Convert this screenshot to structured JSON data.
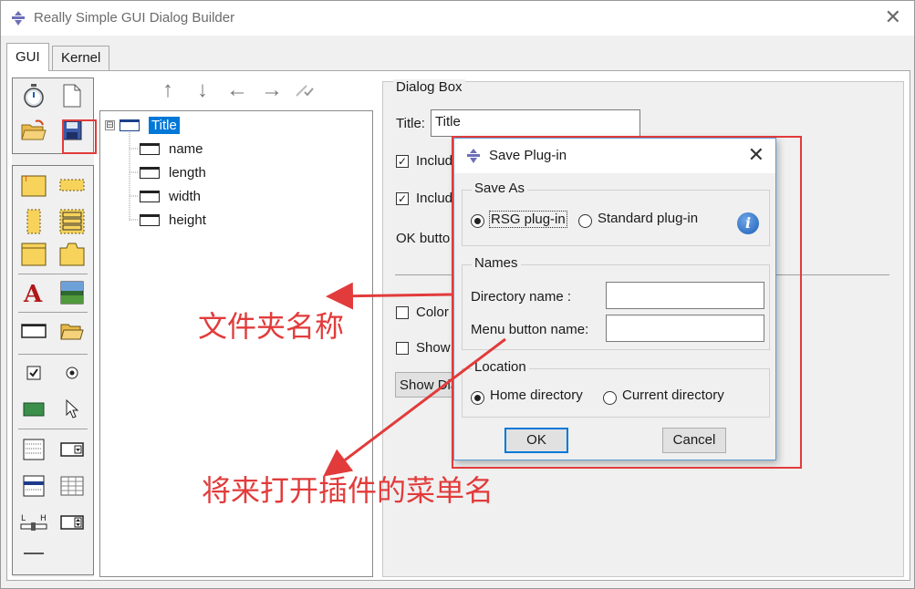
{
  "window": {
    "title": "Really Simple GUI Dialog Builder",
    "close_glyph": "✕"
  },
  "tabs": [
    {
      "label": "GUI",
      "active": true
    },
    {
      "label": "Kernel",
      "active": false
    }
  ],
  "toolbox": {
    "top_icons": [
      "stopwatch-icon",
      "new-document-icon",
      "open-folder-icon",
      "save-floppy-icon"
    ],
    "widget_icons": [
      "dialog-frame-icon",
      "horizontal-frame-icon",
      "vertical-frame-icon",
      "vertical-aligned-icon",
      "tab-book-icon",
      "tab-item-icon",
      "label-text-icon",
      "picture-icon",
      "text-field-icon",
      "file-open-icon",
      "checkbox-icon",
      "radio-button-icon",
      "combo-list-icon",
      "pointer-icon",
      "list-icon",
      "combo-box-icon",
      "table-icon",
      "table-grid-icon",
      "slider-icon",
      "spinner-icon",
      "separator-icon"
    ]
  },
  "nav_arrows": [
    "↑",
    "↓",
    "←",
    "→"
  ],
  "tree": {
    "root": "Title",
    "expander": "⊟",
    "children": [
      "name",
      "length",
      "width",
      "height"
    ]
  },
  "properties": {
    "group_label": "Dialog Box",
    "title_label": "Title:",
    "title_value": "Title",
    "include1_label": "Includ",
    "include2_label": "Includ",
    "ok_label": "OK butto",
    "color_label": "Color",
    "show_label": "Show",
    "show_button": "Show Dia"
  },
  "dialog": {
    "title": "Save Plug-in",
    "close_glyph": "✕",
    "save_as": {
      "legend": "Save As",
      "options": [
        "RSG plug-in",
        "Standard plug-in"
      ],
      "selected": 0,
      "info_glyph": "i"
    },
    "names": {
      "legend": "Names",
      "directory_label": "Directory name :",
      "directory_value": "",
      "menu_label": "Menu button name:",
      "menu_value": ""
    },
    "location": {
      "legend": "Location",
      "options": [
        "Home directory",
        "Current directory"
      ],
      "selected": 0
    },
    "ok_label": "OK",
    "cancel_label": "Cancel"
  },
  "annotations": {
    "folder_name": "文件夹名称",
    "menu_name": "将来打开插件的菜单名",
    "color": "#e23b3b"
  }
}
